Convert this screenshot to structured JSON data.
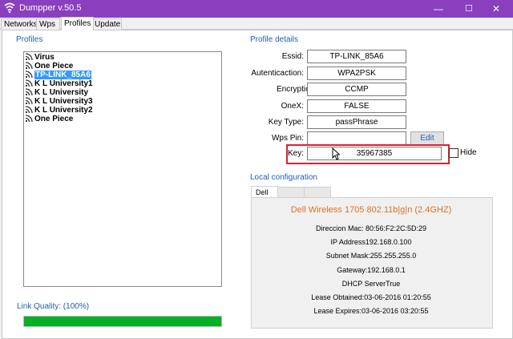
{
  "window": {
    "title": "Dumpper v.50.5",
    "min": "—",
    "max": "☐",
    "close": "✕"
  },
  "tabs": [
    "Networks",
    "Wps",
    "Profiles",
    "Update"
  ],
  "profiles": {
    "label": "Profiles",
    "items": [
      "Virus",
      "One Piece",
      "TP-LINK_85A6",
      "K L University1",
      "K L University",
      "K L University3",
      "K L University2",
      "One Piece"
    ],
    "selected_index": 2
  },
  "link_quality": {
    "label": "Link Quality: (100%)",
    "value": 1.0
  },
  "profile_details": {
    "label": "Profile details",
    "essid_label": "Essid:",
    "essid": "TP-LINK_85A6",
    "auth_label": "Autenticaction:",
    "auth": "WPA2PSK",
    "enc_label": "Encryption:",
    "enc": "CCMP",
    "onex_label": "OneX:",
    "onex": "FALSE",
    "keytype_label": "Key Type:",
    "keytype": "passPhrase",
    "wpspin_label": "Wps Pin:",
    "wpspin": "",
    "edit_label": "Edit",
    "key_label": "Key:",
    "key": "35967385",
    "hide_label": "Hide"
  },
  "local_config": {
    "label": "Local configuration",
    "tabs": [
      "Dell",
      "",
      ""
    ],
    "adapter": "Dell Wireless 1705 802.11b|g|n (2.4GHZ)",
    "mac": "Direccion Mac: 80:56:F2:2C:5D:29",
    "ip": "IP Address192.168.0.100",
    "mask": "Subnet Mask:255.255.255.0",
    "gateway": "Gateway:192.168.0.1",
    "dhcp": "DHCP ServerTrue",
    "lease_obtained": "Lease Obtained:03-06-2016 01:20:55",
    "lease_expires": "Lease Expires:03-06-2016 03:20:55"
  },
  "colors": {
    "titlebar": "#8a3fbf",
    "accent": "#1e5eb0",
    "adapter": "#e07020",
    "highlight": "#d9232c",
    "progress": "#06b025"
  }
}
